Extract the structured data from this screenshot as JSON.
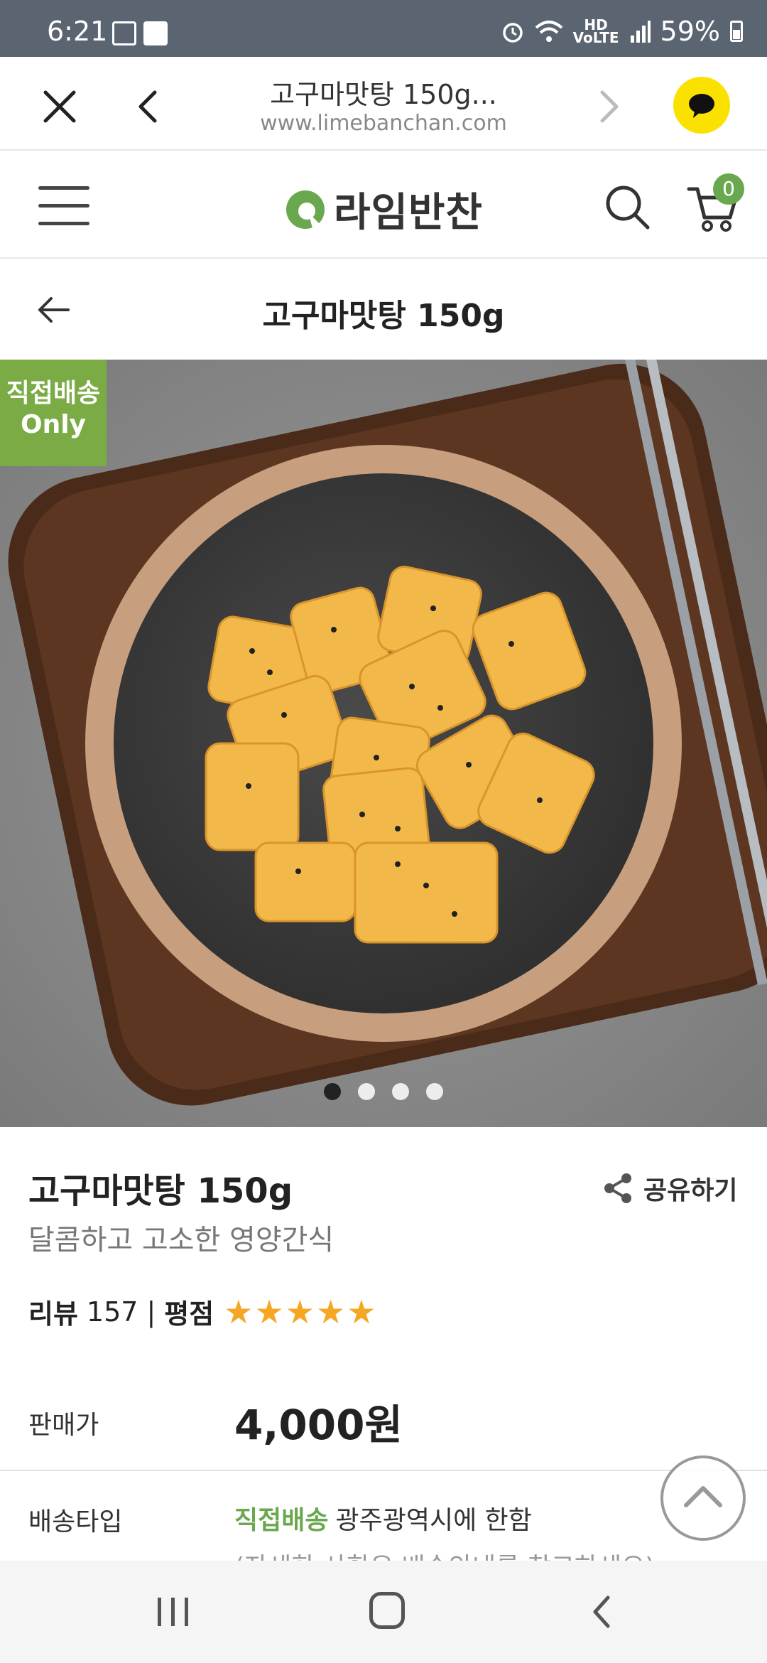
{
  "status_bar": {
    "time": "6:21",
    "network_label": "HD\nVoice",
    "battery": "59%"
  },
  "browser": {
    "page_title": "고구마맛탕 150g...",
    "url": "www.limebanchan.com"
  },
  "site": {
    "logo_text": "라임반찬",
    "cart_count": "0"
  },
  "page": {
    "title": "고구마맛탕 150g"
  },
  "hero": {
    "badge_line1": "직접배송",
    "badge_line2": "Only",
    "slide_count": 4,
    "active_slide": 1
  },
  "product": {
    "name": "고구마맛탕 150g",
    "subtitle": "달콤하고 고소한 영양간식",
    "share_label": "공유하기",
    "review_label": "리뷰",
    "review_count": "157",
    "separator": "|",
    "rating_label": "평점",
    "rating_stars": 5,
    "price_label": "판매가",
    "price": "4,000원",
    "shipping_label": "배송타입",
    "shipping_type": "직접배송",
    "shipping_area": "광주광역시에 한함",
    "shipping_note": "(자세한 사항은 배송안내를 참고하세요)"
  },
  "colors": {
    "brand_green": "#6aa84f",
    "badge_green": "#7aab45",
    "kakao_yellow": "#fae100",
    "star": "#f5a623",
    "status_bar": "#5b6571"
  }
}
